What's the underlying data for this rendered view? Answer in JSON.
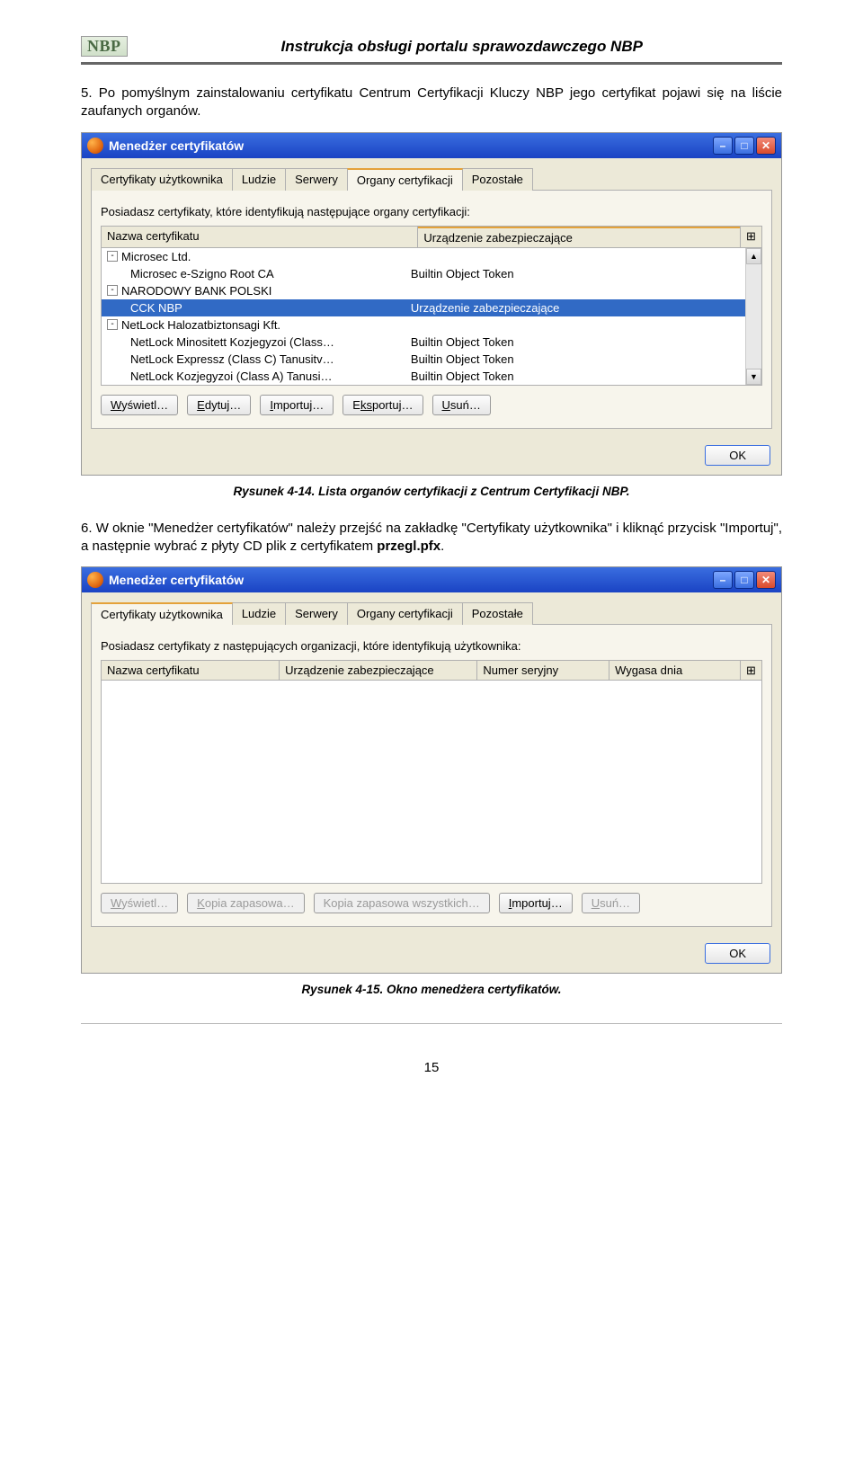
{
  "header": {
    "logo_text": "NBP",
    "doc_title": "Instrukcja obsługi portalu sprawozdawczego NBP"
  },
  "para1": "5. Po pomyślnym zainstalowaniu certyfikatu Centrum Certyfikacji Kluczy NBP jego certyfikat pojawi się na liście zaufanych organów.",
  "window1": {
    "title": "Menedżer certyfikatów",
    "tabs": [
      "Certyfikaty użytkownika",
      "Ludzie",
      "Serwery",
      "Organy certyfikacji",
      "Pozostałe"
    ],
    "active_tab_index": 3,
    "desc": "Posiadasz certyfikaty, które identyfikują następujące organy certyfikacji:",
    "col_name": "Nazwa certyfikatu",
    "col_device": "Urządzenie zabezpieczające",
    "rows": [
      {
        "expand": "-",
        "indent": 0,
        "name": "Microsec Ltd.",
        "device": ""
      },
      {
        "expand": "",
        "indent": 1,
        "name": "Microsec e-Szigno Root CA",
        "device": "Builtin Object Token"
      },
      {
        "expand": "-",
        "indent": 0,
        "name": "NARODOWY BANK POLSKI",
        "device": ""
      },
      {
        "expand": "",
        "indent": 1,
        "name": "CCK NBP",
        "device": "Urządzenie zabezpieczające",
        "selected": true
      },
      {
        "expand": "-",
        "indent": 0,
        "name": "NetLock Halozatbiztonsagi Kft.",
        "device": ""
      },
      {
        "expand": "",
        "indent": 1,
        "name": "NetLock Minositett Kozjegyzoi (Class…",
        "device": "Builtin Object Token"
      },
      {
        "expand": "",
        "indent": 1,
        "name": "NetLock Expressz (Class C) Tanusitv…",
        "device": "Builtin Object Token"
      },
      {
        "expand": "",
        "indent": 1,
        "name": "NetLock Kozjegyzoi (Class A) Tanusi…",
        "device": "Builtin Object Token"
      }
    ],
    "buttons": {
      "view": "Wyświetl…",
      "edit": "Edytuj…",
      "import": "Importuj…",
      "export": "Eksportuj…",
      "delete": "Usuń…"
    },
    "ok": "OK"
  },
  "caption1": "Rysunek 4-14. Lista organów certyfikacji z Centrum Certyfikacji NBP.",
  "para2_prefix": "6. W oknie \"Menedżer certyfikatów\" należy przejść na zakładkę \"Certyfikaty użytkownika\" i kliknąć przycisk \"Importuj\", a następnie wybrać z płyty CD plik z certyfikatem ",
  "para2_bold": "przegl.pfx",
  "para2_suffix": ".",
  "window2": {
    "title": "Menedżer certyfikatów",
    "tabs": [
      "Certyfikaty użytkownika",
      "Ludzie",
      "Serwery",
      "Organy certyfikacji",
      "Pozostałe"
    ],
    "active_tab_index": 0,
    "desc": "Posiadasz certyfikaty z następujących organizacji, które identyfikują użytkownika:",
    "cols": {
      "name": "Nazwa certyfikatu",
      "device": "Urządzenie zabezpieczające",
      "serial": "Numer seryjny",
      "expires": "Wygasa dnia"
    },
    "buttons": {
      "view": "Wyświetl…",
      "backup": "Kopia zapasowa…",
      "backup_all": "Kopia zapasowa wszystkich…",
      "import": "Importuj…",
      "delete": "Usuń…"
    },
    "ok": "OK"
  },
  "caption2": "Rysunek 4-15. Okno menedżera certyfikatów.",
  "page_number": "15",
  "icons": {
    "minimize": "–",
    "maximize": "□",
    "close": "✕",
    "picker": "⊞",
    "up": "▲",
    "down": "▼"
  },
  "hotkeys": {
    "view_W": "W",
    "view_rest": "yświetl…",
    "edit_E": "E",
    "edit_rest": "dytuj…",
    "import_I": "I",
    "import_rest": "mportuj…",
    "export_E": "E",
    "export_pre": "",
    "export_ks": "ks",
    "export_p": "portuj…",
    "delete_U": "U",
    "delete_rest": "suń…",
    "backup_K": "K",
    "backup_rest": "opia zapasowa…",
    "backupall": "Kopia zapasowa wszystkich…"
  }
}
